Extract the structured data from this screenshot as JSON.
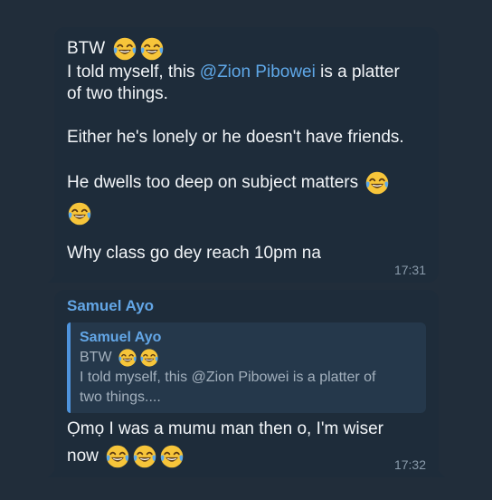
{
  "messages": [
    {
      "lines": {
        "l1": "BTW",
        "l2_pre": "I told myself, this ",
        "l2_mention": "@Zion Pibowei",
        "l2_post": " is a platter",
        "l3": "of two things.",
        "l4": "Either he's lonely or he doesn't have friends.",
        "l5": "He dwells too deep on subject matters",
        "l6": "Why class go dey reach 10pm na"
      },
      "time": "17:31"
    },
    {
      "sender": "Samuel Ayo",
      "reply": {
        "sender": "Samuel Ayo",
        "line1": "BTW",
        "line2": "I told myself, this @Zion Pibowei is a platter of",
        "line3": "two things...."
      },
      "line1": "Ọmọ I was a mumu man then o, I'm wiser",
      "line2": "now",
      "time": "17:32"
    }
  ],
  "icons": {
    "emoji": "face-with-tears-of-joy-icon"
  },
  "colors": {
    "background": "#212d3a",
    "bubble": "#1e2c3a",
    "accent": "#63a6e6",
    "quote_bar": "#4f94dd",
    "timestamp": "#8a9bab"
  }
}
